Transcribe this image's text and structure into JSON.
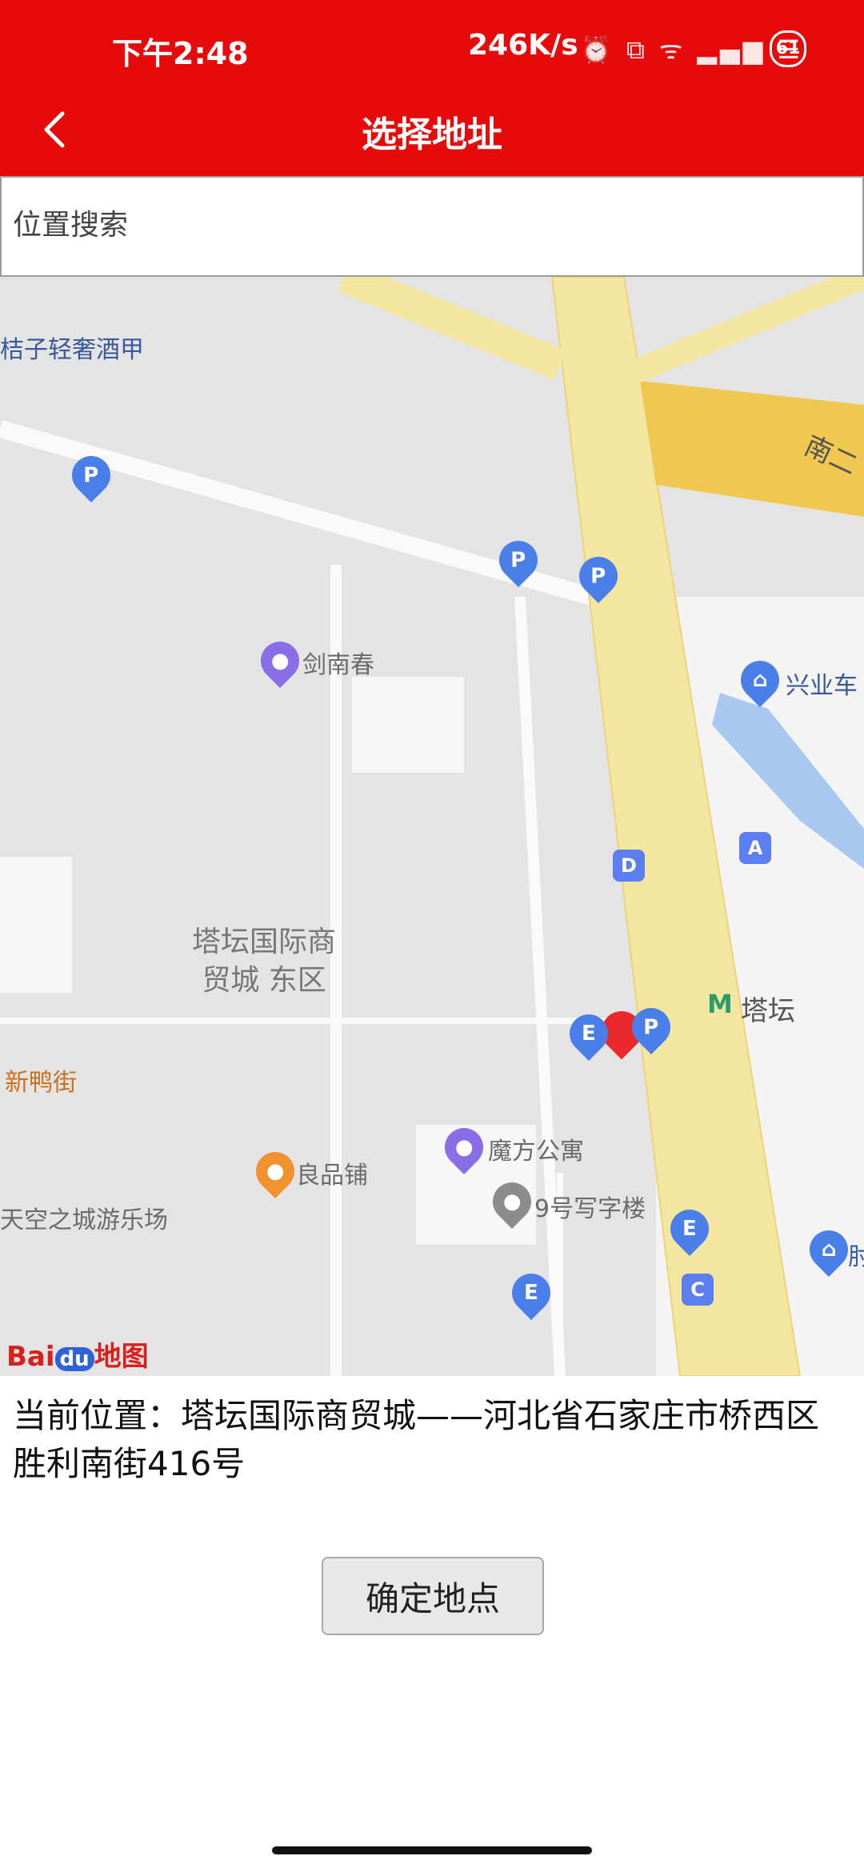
{
  "status_bar": {
    "time": "下午2:48",
    "speed": "246K/s",
    "status_icons": "⏰ ⧉ ᯤ ▂▄▆ ☰",
    "battery": "61"
  },
  "header": {
    "title": "选择地址",
    "back_icon": "chevron-left-icon"
  },
  "search": {
    "placeholder": "位置搜索",
    "value": ""
  },
  "map": {
    "labels": {
      "top_left": "桔子轻奢酒甲",
      "road_nan_er": "南二",
      "jian_nan_chun": "剑南春",
      "xing_ye_che": "兴业车",
      "mall_name_line1": "塔坛国际商",
      "mall_name_line2": "贸城 东区",
      "ta_tan": "塔坛",
      "xin_ya_jie": "新鸭街",
      "mofang": "魔方公寓",
      "liang_pin": "良品铺",
      "tiankong": "天空之城游乐场",
      "office": "9号写字楼",
      "fu": "肘"
    },
    "logo": {
      "bai": "Bai",
      "du": "du",
      "ditu": "地图"
    }
  },
  "current_location": {
    "label": "当前位置：",
    "text": "塔坛国际商贸城——河北省石家庄市桥西区胜利南街416号"
  },
  "confirm_button": {
    "label": "确定地点"
  },
  "colors": {
    "brand_red": "#e60a0a",
    "road_yellow": "#f3e6a0",
    "map_bg": "#e4e4e4",
    "poi_blue": "#4a7ee8"
  }
}
